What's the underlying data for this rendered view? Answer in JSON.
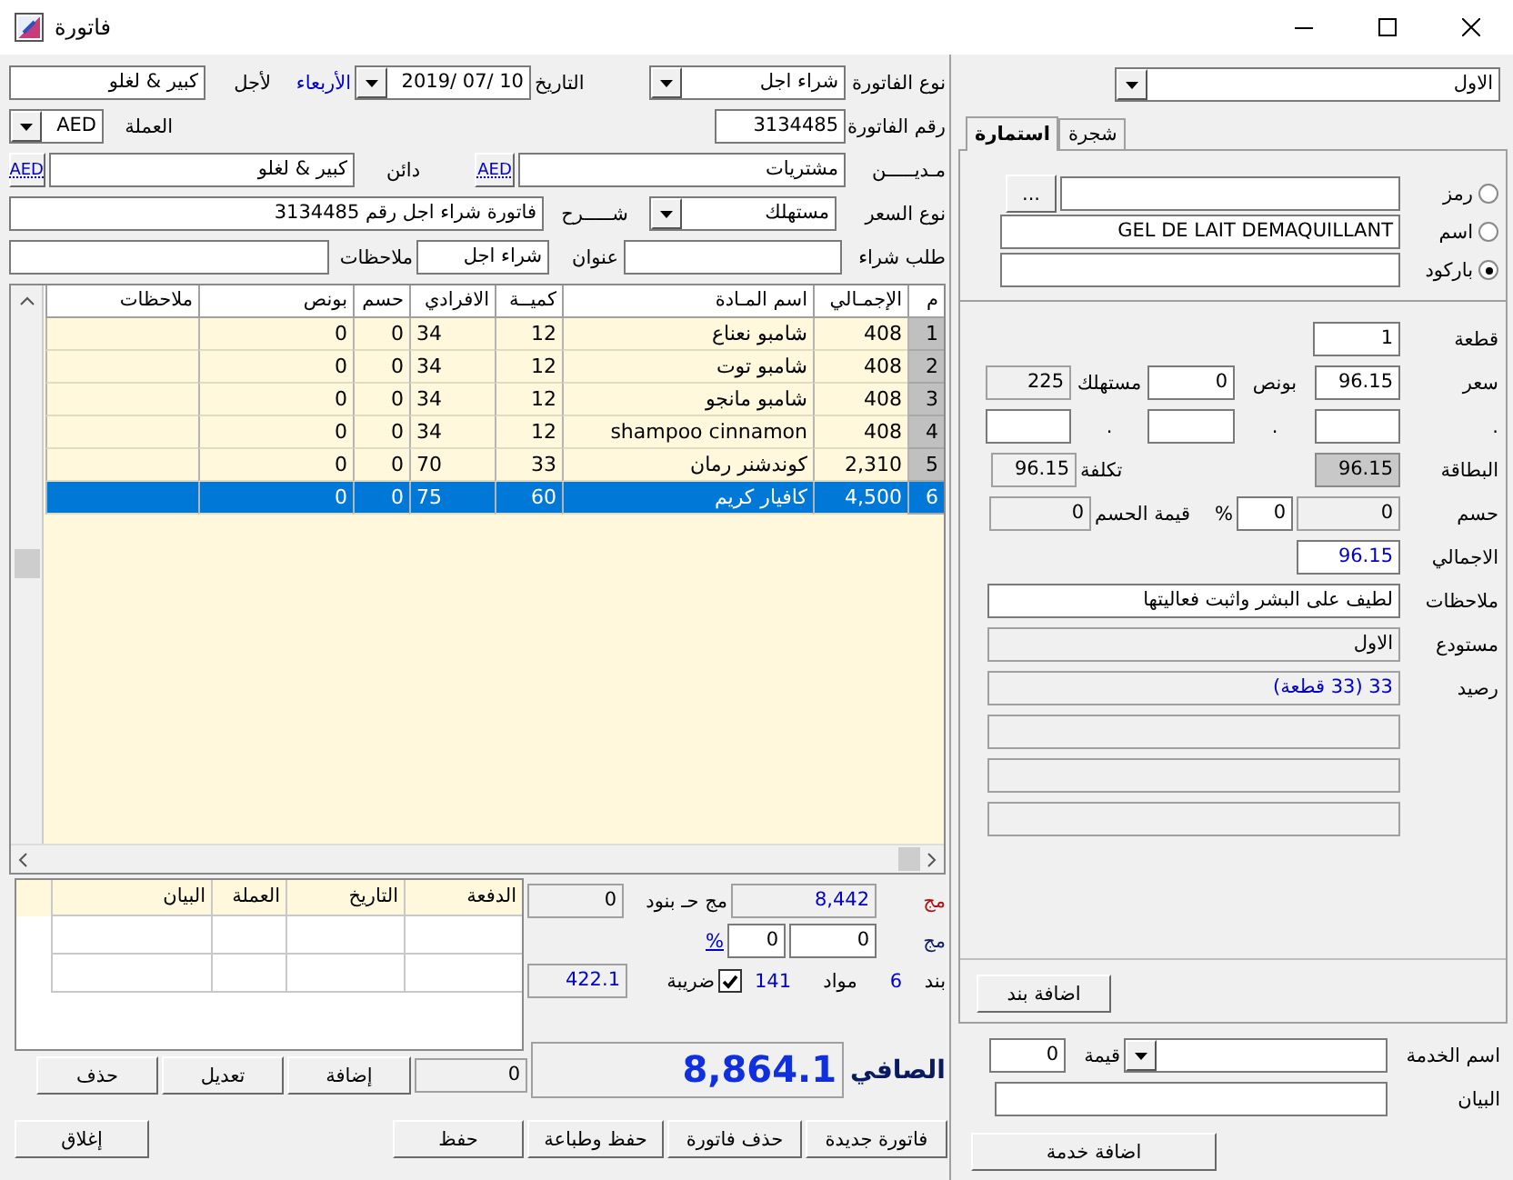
{
  "window": {
    "title": "فاتورة"
  },
  "header": {
    "rows": [
      {
        "right": [
          {
            "kind": "label",
            "text": "نوع الفاتورة"
          },
          {
            "kind": "combo",
            "value": "شراء اجل"
          }
        ],
        "left": [
          {
            "kind": "label",
            "text": "التاريخ"
          },
          {
            "kind": "combo",
            "value": "2019/ 07/ 10"
          },
          {
            "kind": "label",
            "text": "الأربعاء"
          },
          {
            "kind": "label",
            "text": "لأجل"
          },
          {
            "kind": "field",
            "value": "كبير & لغلو",
            "readonly": false
          }
        ]
      },
      {
        "right": [
          {
            "kind": "label",
            "text": "رقم الفاتورة"
          },
          {
            "kind": "field",
            "value": "3134485",
            "readonly": false
          }
        ],
        "left": [
          {
            "kind": "label",
            "text": "العملة"
          },
          {
            "kind": "combo",
            "value": "AED"
          }
        ]
      },
      {
        "right": [
          {
            "kind": "label",
            "text": "مـديـــــن"
          },
          {
            "kind": "field",
            "value": "مشتريات",
            "readonly": false
          },
          {
            "kind": "currency",
            "text": "AED"
          }
        ],
        "left": [
          {
            "kind": "label",
            "text": "دائن"
          },
          {
            "kind": "field",
            "value": "كبير & لغلو",
            "readonly": false
          },
          {
            "kind": "currency",
            "text": "AED"
          }
        ]
      },
      {
        "right": [
          {
            "kind": "label",
            "text": "نوع السعر"
          },
          {
            "kind": "combo",
            "value": "مستهلك"
          }
        ],
        "left": [
          {
            "kind": "label",
            "text": "شـــــرح"
          },
          {
            "kind": "field",
            "value": "فاتورة شراء اجل رقم 3134485",
            "readonly": false
          }
        ]
      },
      {
        "right": [
          {
            "kind": "label",
            "text": "طلب شراء"
          },
          {
            "kind": "field",
            "readonly": false
          }
        ],
        "left": [
          {
            "kind": "label",
            "text": "عنوان"
          },
          {
            "kind": "field",
            "value": "شراء اجل",
            "readonly": false
          },
          {
            "kind": "label",
            "text": "ملاحظات"
          },
          {
            "kind": "field",
            "readonly": false
          }
        ]
      }
    ]
  },
  "items_table": {
    "columns": [
      "م",
      "الإجمـالي",
      "اسم المـادة",
      "كميــة",
      "الافرادي",
      "حسم",
      "بونص",
      "ملاحظات"
    ],
    "rows": [
      {
        "cells": [
          "1",
          "408",
          "شامبو نعناع",
          "12",
          "34",
          "0",
          "0"
        ],
        "selected": false
      },
      {
        "cells": [
          "2",
          "408",
          "شامبو توت",
          "12",
          "34",
          "0",
          "0"
        ],
        "selected": false
      },
      {
        "cells": [
          "3",
          "408",
          "شامبو مانجو",
          "12",
          "34",
          "0",
          "0"
        ],
        "selected": false
      },
      {
        "cells": [
          "4",
          "408",
          "shampoo cinnamon",
          "12",
          "34",
          "0",
          "0"
        ],
        "selected": false
      },
      {
        "cells": [
          "5",
          "2,310",
          "كوندشنر رمان",
          "33",
          "70",
          "0",
          "0"
        ],
        "selected": false
      },
      {
        "cells": [
          "6",
          "4,500",
          "كافيار كريم",
          "60",
          "75",
          "0",
          "0"
        ],
        "selected": true
      }
    ]
  },
  "payments": {
    "columns": [
      "الدفعة",
      "التاريخ",
      "العملة",
      "البيان"
    ],
    "controls": [
      {
        "kind": "field",
        "value": "0",
        "readonly": true
      },
      {
        "kind": "button",
        "text": "إضافة"
      },
      {
        "kind": "button",
        "text": "تعديل"
      },
      {
        "kind": "button",
        "text": "حذف"
      }
    ]
  },
  "totals": {
    "rows": [
      {
        "right": [
          {
            "kind": "label",
            "text": "مج"
          },
          {
            "kind": "field",
            "value": "8,442",
            "readonly": true
          }
        ],
        "left": [
          {
            "kind": "label",
            "text": "مج حـ بنود"
          },
          {
            "kind": "field",
            "value": "0",
            "readonly": true
          }
        ]
      },
      {
        "right": [
          {
            "kind": "label",
            "text": "مج"
          },
          {
            "kind": "field",
            "value": "0",
            "readonly": false
          },
          {
            "kind": "field",
            "value": "0",
            "readonly": false
          },
          {
            "kind": "link",
            "text": "%"
          }
        ]
      },
      {
        "right": [
          {
            "kind": "label",
            "text": "بند"
          },
          {
            "kind": "value",
            "text": "6"
          },
          {
            "kind": "label",
            "text": "مواد"
          },
          {
            "kind": "value",
            "text": "141"
          },
          {
            "kind": "checkbox",
            "checked": true
          },
          {
            "kind": "label",
            "text": "ضريبة"
          }
        ],
        "left": [
          {
            "kind": "field",
            "value": "422.1",
            "readonly": true
          }
        ]
      },
      {
        "right": [
          {
            "kind": "label",
            "text": "الصافي"
          },
          {
            "kind": "field",
            "value": "8,864.1",
            "readonly": true
          }
        ]
      }
    ]
  },
  "actions": [
    {
      "kind": "button",
      "text": "فاتورة جديدة"
    },
    {
      "kind": "button",
      "text": "حذف فاتورة"
    },
    {
      "kind": "button",
      "text": "حفظ وطباعة"
    },
    {
      "kind": "button",
      "text": "حفظ"
    },
    {
      "kind": "button",
      "text": "إغلاق"
    }
  ],
  "side": {
    "warehouse": {
      "kind": "combo",
      "value": "الاول"
    },
    "tabs": [
      {
        "label": "شجرة",
        "selected": false
      },
      {
        "label": "استمارة",
        "selected": true
      }
    ],
    "search_rows": [
      [
        {
          "kind": "radio",
          "text": "رمز",
          "checked": false
        },
        {
          "kind": "field",
          "readonly": false
        },
        {
          "kind": "button",
          "text": "..."
        }
      ],
      [
        {
          "kind": "radio",
          "text": "اسم",
          "checked": false
        },
        {
          "kind": "field",
          "value": "GEL DE LAIT DEMAQUILLANT",
          "readonly": false
        }
      ],
      [
        {
          "kind": "radio",
          "text": "باركود",
          "checked": true
        },
        {
          "kind": "field",
          "readonly": false
        }
      ]
    ],
    "detail_rows": [
      [
        {
          "kind": "label",
          "text": "قطعة"
        },
        {
          "kind": "field",
          "value": "1",
          "readonly": false
        }
      ],
      [
        {
          "kind": "label",
          "text": "سعر"
        },
        {
          "kind": "field",
          "value": "96.15",
          "readonly": false
        },
        {
          "kind": "label",
          "text": "بونص"
        },
        {
          "kind": "field",
          "value": "0",
          "readonly": false
        },
        {
          "kind": "label",
          "text": "مستهلك"
        },
        {
          "kind": "field",
          "value": "225",
          "readonly": true
        }
      ],
      [
        {
          "kind": "label",
          "text": "."
        },
        {
          "kind": "field",
          "readonly": false
        },
        {
          "kind": "label",
          "text": "."
        },
        {
          "kind": "field",
          "readonly": false
        },
        {
          "kind": "label",
          "text": "."
        },
        {
          "kind": "field",
          "readonly": false
        }
      ],
      [
        {
          "kind": "label",
          "text": "البطاقة"
        },
        {
          "kind": "field",
          "value": "96.15",
          "readonly": true
        },
        {
          "kind": "label",
          "text": "تكلفة"
        },
        {
          "kind": "field",
          "value": "96.15",
          "readonly": true
        }
      ],
      [
        {
          "kind": "label",
          "text": "حسم"
        },
        {
          "kind": "field",
          "value": "0",
          "readonly": true
        },
        {
          "kind": "field",
          "value": "0",
          "readonly": false
        },
        {
          "kind": "label",
          "text": "%"
        },
        {
          "kind": "label",
          "text": "قيمة الحسم"
        },
        {
          "kind": "field",
          "value": "0",
          "readonly": true
        }
      ],
      [
        {
          "kind": "label",
          "text": "الاجمالي"
        },
        {
          "kind": "field",
          "value": "96.15",
          "readonly": false
        }
      ],
      [
        {
          "kind": "label",
          "text": "ملاحظات"
        },
        {
          "kind": "field",
          "value": "لطيف على البشر واثبت فعاليتها",
          "readonly": false
        }
      ],
      [
        {
          "kind": "label",
          "text": "مستودع"
        },
        {
          "kind": "field",
          "value": "الاول",
          "readonly": true
        }
      ],
      [
        {
          "kind": "label",
          "text": "رصيد"
        },
        {
          "kind": "field",
          "value": "33 (33 قطعة)",
          "readonly": true
        }
      ],
      [
        {
          "kind": "field",
          "readonly": true
        }
      ],
      [
        {
          "kind": "field",
          "readonly": true
        }
      ],
      [
        {
          "kind": "field",
          "readonly": true
        }
      ]
    ],
    "add_item_button": {
      "kind": "button",
      "text": "اضافة بند"
    },
    "service_rows": [
      [
        {
          "kind": "label",
          "text": "اسم الخدمة"
        },
        {
          "kind": "combo"
        },
        {
          "kind": "label",
          "text": "قيمة"
        },
        {
          "kind": "field",
          "value": "0",
          "readonly": false
        }
      ],
      [
        {
          "kind": "label",
          "text": "البيان"
        },
        {
          "kind": "field",
          "readonly": false
        }
      ]
    ],
    "add_service_button": {
      "kind": "button",
      "text": "اضافة خدمة"
    }
  }
}
